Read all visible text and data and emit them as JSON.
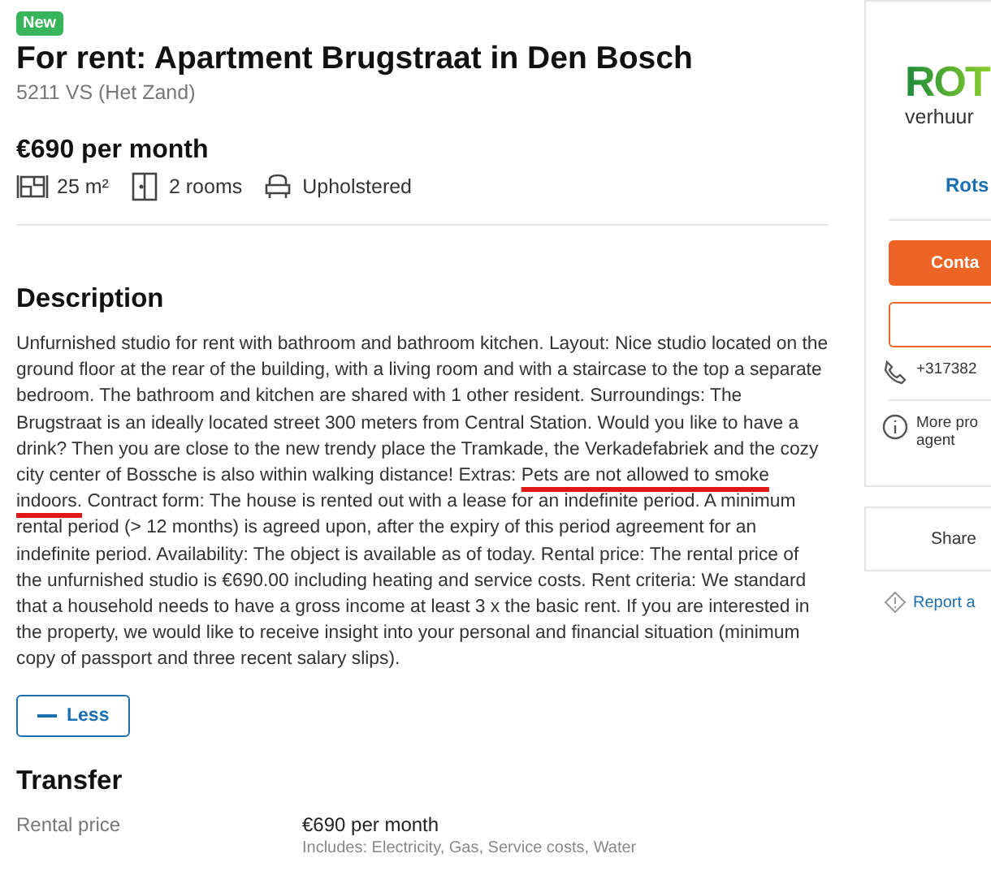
{
  "listing": {
    "badge": "New",
    "title": "For rent: Apartment Brugstraat in Den Bosch",
    "address": "5211 VS (Het Zand)",
    "price": "€690 per month",
    "features": [
      {
        "kind": "area",
        "label": "25 m²"
      },
      {
        "kind": "rooms",
        "label": "2 rooms"
      },
      {
        "kind": "furnishing",
        "label": "Upholstered"
      }
    ]
  },
  "description": {
    "heading": "Description",
    "text_start": "Unfurnished studio for rent with bathroom and bathroom kitchen. Layout: Nice studio located on the ground floor at the rear of the building, with a living room and with a staircase to the top a separate bedroom. The bathroom and kitchen are shared with 1 other resident. Surroundings: The Brugstraat is an ideally located street 300 meters from Central Station. Would you like to have a drink? Then you are close to the new trendy place the Tramkade, the Verkadefabriek and the cozy city center of Bossche is also within walking distance! Extras: ",
    "underlined_text": "Pets are not allowed to smoke indoors.",
    "text_end": " Contract form: The house is rented out with a lease for an indefinite period. A minimum rental period (> 12 months) is agreed upon, after the expiry of this period agreement for an indefinite period. Availability: The object is available as of today. Rental price: The rental price of the unfurnished studio is €690.00 including heating and service costs. Rent criteria: We standard that a household needs to have a gross income at least 3 x the basic rent. If you are interested in the property, we would like to receive insight into your personal and financial situation (minimum copy of passport and three recent salary slips).",
    "toggle": "Less"
  },
  "transfer": {
    "heading": "Transfer",
    "rows": [
      {
        "label": "Rental price",
        "value": "€690 per month",
        "note": "Includes: Electricity, Gas, Service costs, Water"
      }
    ]
  },
  "agent": {
    "logo": "ROT",
    "logo_sub": "verhuur",
    "name": "Rots",
    "contact_button": "Conta",
    "phone": "+317382",
    "more": "More pro",
    "more_line2": "agent",
    "share": "Share",
    "report": "Report a"
  }
}
